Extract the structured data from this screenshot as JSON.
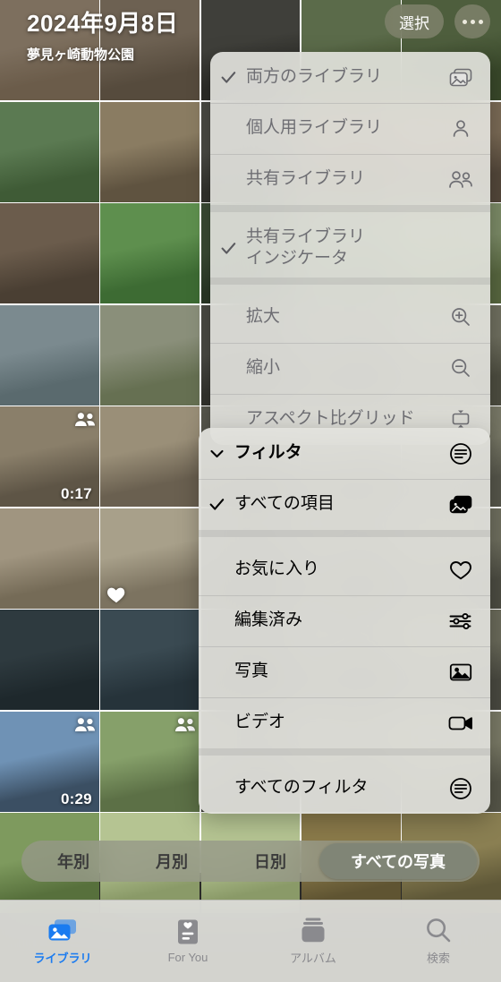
{
  "header": {
    "date_title": "2024年9月8日",
    "place_title": "夢見ヶ崎動物公園",
    "select_label": "選択",
    "more_icon": "ellipsis-icon"
  },
  "library_menu": {
    "items": [
      {
        "label": "両方のライブラリ",
        "checked": true,
        "icon": "photo-stack-icon",
        "dim": true
      },
      {
        "label": "個人用ライブラリ",
        "checked": false,
        "icon": "person-icon",
        "dim": true
      },
      {
        "label": "共有ライブラリ",
        "checked": false,
        "icon": "two-persons-icon",
        "dim": true
      },
      {
        "label": "共有ライブラリ\nインジケータ",
        "checked": true,
        "icon": "",
        "dim": true,
        "gap_before": true
      },
      {
        "label": "拡大",
        "checked": false,
        "icon": "zoom-in-icon",
        "dim": true,
        "gap_before": true
      },
      {
        "label": "縮小",
        "checked": false,
        "icon": "zoom-out-icon",
        "dim": true
      },
      {
        "label": "アスペクト比グリッド",
        "checked": false,
        "icon": "aspect-grid-icon",
        "dim": true
      }
    ]
  },
  "filter_menu": {
    "title": "フィルタ",
    "title_icon": "filter-icon",
    "items": [
      {
        "label": "すべての項目",
        "checked": true,
        "icon": "photo-stack-icon"
      },
      {
        "label": "お気に入り",
        "checked": false,
        "icon": "heart-icon",
        "gap_before": true
      },
      {
        "label": "編集済み",
        "checked": false,
        "icon": "sliders-icon"
      },
      {
        "label": "写真",
        "checked": false,
        "icon": "photo-icon"
      },
      {
        "label": "ビデオ",
        "checked": false,
        "icon": "video-icon"
      },
      {
        "label": "すべてのフィルタ",
        "checked": false,
        "icon": "filter-icon",
        "gap_before": true
      }
    ]
  },
  "segmented": {
    "options": [
      "年別",
      "月別",
      "日別",
      "すべての写真"
    ],
    "active_index": 3
  },
  "tabbar": {
    "tabs": [
      {
        "label": "ライブラリ",
        "icon": "library-icon",
        "active": true
      },
      {
        "label": "For You",
        "icon": "for-you-icon",
        "active": false
      },
      {
        "label": "アルバム",
        "icon": "albums-icon",
        "active": false
      },
      {
        "label": "検索",
        "icon": "search-icon",
        "active": false
      }
    ]
  },
  "colors": {
    "accent": "#1a7bf0",
    "menu_bg": "#e5e5e1",
    "pill_bg": "#80826c",
    "inactive_label": "#8a8a8e"
  },
  "grid": {
    "columns": 5,
    "cells": [
      {
        "r": 0,
        "c": 0,
        "sky": "#7d6f5e",
        "ground": "#6b5c4a"
      },
      {
        "r": 0,
        "c": 1,
        "sky": "#6d6152",
        "ground": "#564b3d"
      },
      {
        "r": 0,
        "c": 2,
        "sky": "#3f3f3a",
        "ground": "#2c2c28"
      },
      {
        "r": 0,
        "c": 3,
        "sky": "#5b6b4a",
        "ground": "#44532f"
      },
      {
        "r": 0,
        "c": 4,
        "sky": "#4e5e3d",
        "ground": "#39482a"
      },
      {
        "r": 1,
        "c": 0,
        "sky": "#5b7a52",
        "ground": "#3f5b36"
      },
      {
        "r": 1,
        "c": 1,
        "sky": "#8a7c62",
        "ground": "#5f5340"
      },
      {
        "r": 1,
        "c": 2,
        "sky": "#4a4a44",
        "ground": "#32322d"
      },
      {
        "r": 1,
        "c": 3,
        "sky": "#6f5f4c",
        "ground": "#4d4134"
      },
      {
        "r": 1,
        "c": 4,
        "sky": "#7a6a55",
        "ground": "#53473a"
      },
      {
        "r": 2,
        "c": 0,
        "sky": "#6b5c4c",
        "ground": "#4a3f33",
        "badge": ""
      },
      {
        "r": 2,
        "c": 1,
        "sky": "#5e8f4e",
        "ground": "#3d6b33"
      },
      {
        "r": 2,
        "c": 2,
        "sky": "#3a4a34",
        "ground": "#2a3726"
      },
      {
        "r": 2,
        "c": 3,
        "sky": "#6a7a5a",
        "ground": "#4b5a3e"
      },
      {
        "r": 2,
        "c": 4,
        "sky": "#7b8a66",
        "ground": "#57663f"
      },
      {
        "r": 3,
        "c": 0,
        "sky": "#7b8a8f",
        "ground": "#5a6a6e"
      },
      {
        "r": 3,
        "c": 1,
        "sky": "#8a8f7a",
        "ground": "#667052"
      },
      {
        "r": 3,
        "c": 2,
        "sky": "#4a4a44",
        "ground": "#33332e"
      },
      {
        "r": 3,
        "c": 3,
        "sky": "#5a5a50",
        "ground": "#3e3e36"
      },
      {
        "r": 3,
        "c": 4,
        "sky": "#6f6f5f",
        "ground": "#4d4d40"
      },
      {
        "r": 4,
        "c": 0,
        "sky": "#8a7f6a",
        "ground": "#5e5546",
        "badge": "shared",
        "duration": "0:17"
      },
      {
        "r": 4,
        "c": 1,
        "sky": "#9a8f78",
        "ground": "#6a6050"
      },
      {
        "r": 4,
        "c": 2,
        "sky": "#59594f",
        "ground": "#3d3d35"
      },
      {
        "r": 4,
        "c": 3,
        "sky": "#6a6a5a",
        "ground": "#494940"
      },
      {
        "r": 4,
        "c": 4,
        "sky": "#7a7a68",
        "ground": "#55554a"
      },
      {
        "r": 5,
        "c": 0,
        "sky": "#a09580",
        "ground": "#756b57"
      },
      {
        "r": 5,
        "c": 1,
        "sky": "#a8a08a",
        "ground": "#7c7360",
        "favorite": true
      },
      {
        "r": 5,
        "c": 2,
        "sky": "#4e4e46",
        "ground": "#363630"
      },
      {
        "r": 5,
        "c": 3,
        "sky": "#5e5e52",
        "ground": "#41413a"
      },
      {
        "r": 5,
        "c": 4,
        "sky": "#6e6e5e",
        "ground": "#4c4c42"
      },
      {
        "r": 6,
        "c": 0,
        "sky": "#2e3a3f",
        "ground": "#1e282c"
      },
      {
        "r": 6,
        "c": 1,
        "sky": "#3a4a52",
        "ground": "#26333a"
      },
      {
        "r": 6,
        "c": 2,
        "sky": "#4a4a42",
        "ground": "#33332d"
      },
      {
        "r": 6,
        "c": 3,
        "sky": "#5a5a4e",
        "ground": "#3e3e36"
      },
      {
        "r": 6,
        "c": 4,
        "sky": "#6a6a5a",
        "ground": "#494940"
      },
      {
        "r": 7,
        "c": 0,
        "sky": "#6f92b5",
        "ground": "#3b4f63",
        "badge": "shared",
        "duration": "0:29"
      },
      {
        "r": 7,
        "c": 1,
        "sky": "#86a06a",
        "ground": "#5c7046",
        "badge": "shared"
      },
      {
        "r": 7,
        "c": 2,
        "sky": "#5a5a50",
        "ground": "#3e3e36"
      },
      {
        "r": 7,
        "c": 3,
        "sky": "#6a6a5a",
        "ground": "#494940"
      },
      {
        "r": 7,
        "c": 4,
        "sky": "#7a7a66",
        "ground": "#555548"
      },
      {
        "r": 8,
        "c": 0,
        "sky": "#7e9a5e",
        "ground": "#57703c"
      },
      {
        "r": 8,
        "c": 1,
        "sky": "#b5c492",
        "ground": "#8a9a68"
      },
      {
        "r": 8,
        "c": 2,
        "sky": "#b5c492",
        "ground": "#8a9a68"
      },
      {
        "r": 8,
        "c": 3,
        "sky": "#8a7a4a",
        "ground": "#5f5432"
      },
      {
        "r": 8,
        "c": 4,
        "sky": "#8a7f52",
        "ground": "#5f5838"
      }
    ]
  }
}
